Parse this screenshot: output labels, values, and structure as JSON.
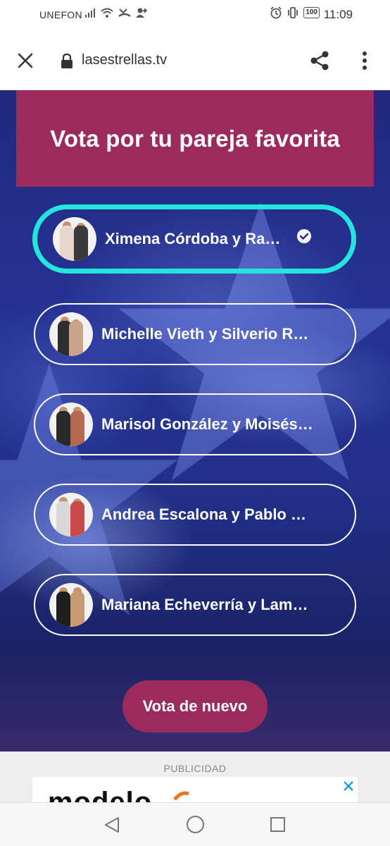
{
  "status_bar": {
    "carrier": "UNEFON",
    "battery": "100",
    "time": "11:09"
  },
  "browser": {
    "url": "lasestrellas.tv"
  },
  "poll": {
    "title": "Vota por tu pareja favorita",
    "options": [
      {
        "label": "Ximena Córdoba y Ra…",
        "selected": true
      },
      {
        "label": "Michelle Vieth y Silverio R…",
        "selected": false
      },
      {
        "label": "Marisol González y Moisés…",
        "selected": false
      },
      {
        "label": "Andrea Escalona y Pablo …",
        "selected": false
      },
      {
        "label": "Mariana Echeverría y Lam…",
        "selected": false
      }
    ],
    "vote_again_label": "Vota de nuevo"
  },
  "ad": {
    "label": "PUBLICIDAD",
    "brand_text": "modelo"
  },
  "colors": {
    "accent": "#9b2a5d",
    "selected_border": "#25e3de",
    "background": "#22308a"
  }
}
